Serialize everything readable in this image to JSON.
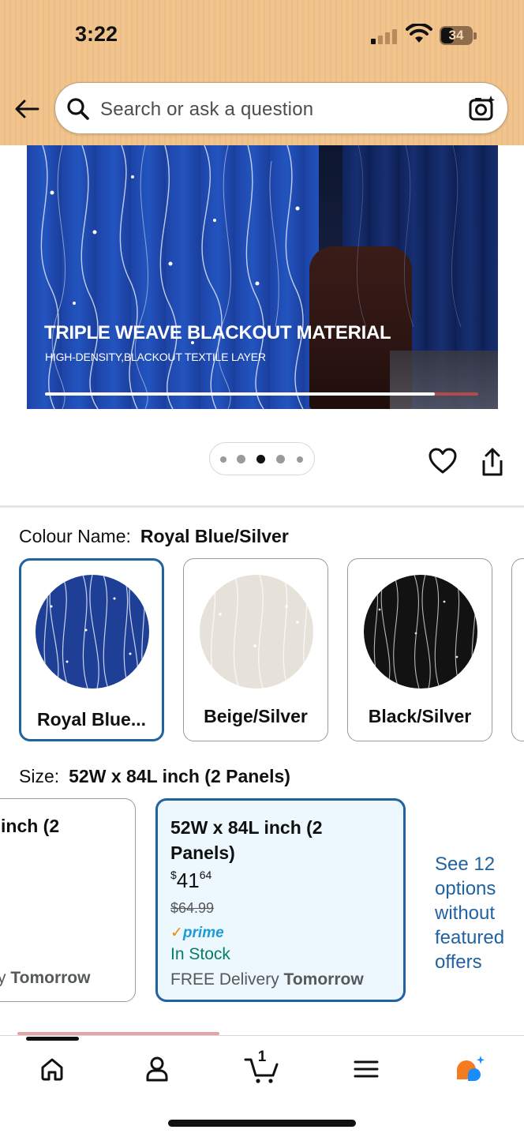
{
  "status_bar": {
    "time": "3:22",
    "battery": "34"
  },
  "search": {
    "placeholder": "Search or ask a question"
  },
  "product_image": {
    "title": "TRIPLE WEAVE BLACKOUT MATERIAL",
    "subtitle": "HIGH-DENSITY,BLACKOUT TEXTILE LAYER",
    "progress": 0.9,
    "image_count": 5,
    "active_image": 3
  },
  "colour": {
    "label": "Colour Name:",
    "selected": "Royal Blue/Silver",
    "options": [
      {
        "label": "Royal Blue...",
        "color": "#1e3f95",
        "selected": true
      },
      {
        "label": "Beige/Silver",
        "color": "#e6e2da",
        "selected": false
      },
      {
        "label": "Black/Silver",
        "color": "#121212",
        "selected": false
      }
    ]
  },
  "size": {
    "label": "Size:",
    "selected": "52W x 84L inch (2 Panels)",
    "prev_option": {
      "title": "inch (2",
      "delivery_bold": "Tomorrow",
      "delivery_prefix": "y"
    },
    "selected_option": {
      "title": "52W x 84L inch (2 Panels)",
      "price_symbol": "$",
      "price_whole": "41",
      "price_fraction": "64",
      "list_price": "$64.99",
      "prime": "prime",
      "stock": "In Stock",
      "delivery_prefix": "FREE Delivery",
      "delivery_bold": "Tomorrow"
    },
    "see_more": "See 12 options without featured offers"
  },
  "bottom_nav": {
    "items": [
      "home-icon",
      "account-icon",
      "cart-icon",
      "menu-icon",
      "rufus-icon"
    ],
    "cart_count": "1"
  },
  "colors": {
    "header": "#f1c48d",
    "selected_border": "#2162a1",
    "link": "#2162a1",
    "in_stock": "#067d62",
    "prime_blue": "#1e9bd7",
    "rufus_orange": "#f47b20",
    "rufus_blue": "#1a8cff"
  }
}
